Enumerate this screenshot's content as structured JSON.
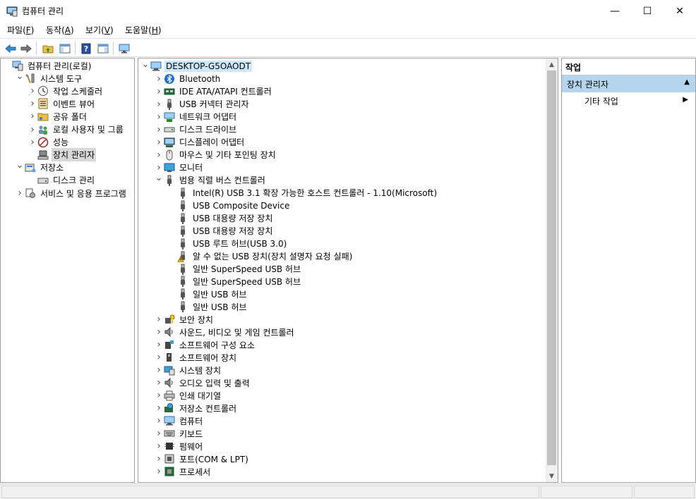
{
  "window": {
    "title": "컴퓨터 관리",
    "controls": {
      "minimize": "—",
      "maximize": "☐",
      "close": "✕"
    }
  },
  "menubar": [
    {
      "label": "파일(",
      "key": "F",
      "end": ")"
    },
    {
      "label": "동작(",
      "key": "A",
      "end": ")"
    },
    {
      "label": "보기(",
      "key": "V",
      "end": ")"
    },
    {
      "label": "도움말(",
      "key": "H",
      "end": ")"
    }
  ],
  "toolbar": {
    "icons": [
      "back-arrow-icon",
      "forward-arrow-icon",
      "up-folder-icon",
      "show-hide-tree-icon",
      "help-icon",
      "action-pane-icon",
      "monitor-scan-icon"
    ]
  },
  "left_tree": {
    "items": [
      {
        "label": "컴퓨터 관리(로컬)",
        "level": 0,
        "chev": "",
        "icon": "computer-management-icon"
      },
      {
        "label": "시스템 도구",
        "level": 1,
        "chev": "v",
        "icon": "tools-icon"
      },
      {
        "label": "작업 스케줄러",
        "level": 2,
        "chev": ">",
        "icon": "clock-icon"
      },
      {
        "label": "이벤트 뷰어",
        "level": 2,
        "chev": ">",
        "icon": "event-viewer-icon"
      },
      {
        "label": "공유 폴더",
        "level": 2,
        "chev": ">",
        "icon": "shared-folder-icon"
      },
      {
        "label": "로컬 사용자 및 그룹",
        "level": 2,
        "chev": ">",
        "icon": "users-icon"
      },
      {
        "label": "성능",
        "level": 2,
        "chev": ">",
        "icon": "performance-icon"
      },
      {
        "label": "장치 관리자",
        "level": 2,
        "chev": "",
        "icon": "device-manager-icon",
        "selected": true
      },
      {
        "label": "저장소",
        "level": 1,
        "chev": "v",
        "icon": "storage-icon"
      },
      {
        "label": "디스크 관리",
        "level": 2,
        "chev": "",
        "icon": "disk-management-icon"
      },
      {
        "label": "서비스 및 응용 프로그램",
        "level": 1,
        "chev": ">",
        "icon": "services-icon"
      }
    ]
  },
  "device_tree": {
    "root": {
      "label": "DESKTOP-G5OAODT",
      "icon": "computer-icon"
    },
    "categories": [
      {
        "label": "Bluetooth",
        "icon": "bluetooth-icon",
        "expanded": false
      },
      {
        "label": "IDE ATA/ATAPI 컨트롤러",
        "icon": "ide-controller-icon",
        "expanded": false
      },
      {
        "label": "USB 커넥터 관리자",
        "icon": "usb-icon",
        "expanded": false
      },
      {
        "label": "네트워크 어댑터",
        "icon": "network-adapter-icon",
        "expanded": false
      },
      {
        "label": "디스크 드라이브",
        "icon": "disk-drive-icon",
        "expanded": false
      },
      {
        "label": "디스플레이 어댑터",
        "icon": "display-adapter-icon",
        "expanded": false
      },
      {
        "label": "마우스 및 기타 포인팅 장치",
        "icon": "mouse-icon",
        "expanded": false
      },
      {
        "label": "모니터",
        "icon": "monitor-icon",
        "expanded": false
      },
      {
        "label": "범용 직렬 버스 컨트롤러",
        "icon": "usb-icon",
        "expanded": true,
        "children": [
          {
            "label": "Intel(R) USB 3.1 확장 가능한 호스트 컨트롤러 - 1.10(Microsoft)",
            "icon": "usb-icon"
          },
          {
            "label": "USB Composite Device",
            "icon": "usb-icon"
          },
          {
            "label": "USB 대용량 저장 장치",
            "icon": "usb-icon"
          },
          {
            "label": "USB 대용량 저장 장치",
            "icon": "usb-icon"
          },
          {
            "label": "USB 루트 허브(USB 3.0)",
            "icon": "usb-icon"
          },
          {
            "label": "알 수 없는 USB 장치(장치 설명자 요청 실패)",
            "icon": "usb-warning-icon"
          },
          {
            "label": "일반 SuperSpeed USB 허브",
            "icon": "usb-icon"
          },
          {
            "label": "일반 SuperSpeed USB 허브",
            "icon": "usb-icon"
          },
          {
            "label": "일반 USB 허브",
            "icon": "usb-icon"
          },
          {
            "label": "일반 USB 허브",
            "icon": "usb-icon"
          }
        ]
      },
      {
        "label": "보안 장치",
        "icon": "security-device-icon",
        "expanded": false
      },
      {
        "label": "사운드, 비디오 및 게임 컨트롤러",
        "icon": "speaker-icon",
        "expanded": false
      },
      {
        "label": "소프트웨어 구성 요소",
        "icon": "software-component-icon",
        "expanded": false
      },
      {
        "label": "소프트웨어 장치",
        "icon": "software-device-icon",
        "expanded": false
      },
      {
        "label": "시스템 장치",
        "icon": "system-device-icon",
        "expanded": false
      },
      {
        "label": "오디오 입력 및 출력",
        "icon": "speaker-icon",
        "expanded": false
      },
      {
        "label": "인쇄 대기열",
        "icon": "printer-icon",
        "expanded": false
      },
      {
        "label": "저장소 컨트롤러",
        "icon": "storage-controller-icon",
        "expanded": false
      },
      {
        "label": "컴퓨터",
        "icon": "computer-icon",
        "expanded": false
      },
      {
        "label": "키보드",
        "icon": "keyboard-icon",
        "expanded": false
      },
      {
        "label": "펌웨어",
        "icon": "firmware-icon",
        "expanded": false
      },
      {
        "label": "포트(COM & LPT)",
        "icon": "port-icon",
        "expanded": false
      },
      {
        "label": "프로세서",
        "icon": "processor-icon",
        "expanded": false
      }
    ]
  },
  "actions_pane": {
    "header": "작업",
    "section": "장치 관리자",
    "items": [
      "기타 작업"
    ]
  },
  "colors": {
    "selection_gray": "#d9d9d9",
    "root_highlight": "#cce8ff",
    "actions_section": "#b4d5ed"
  }
}
